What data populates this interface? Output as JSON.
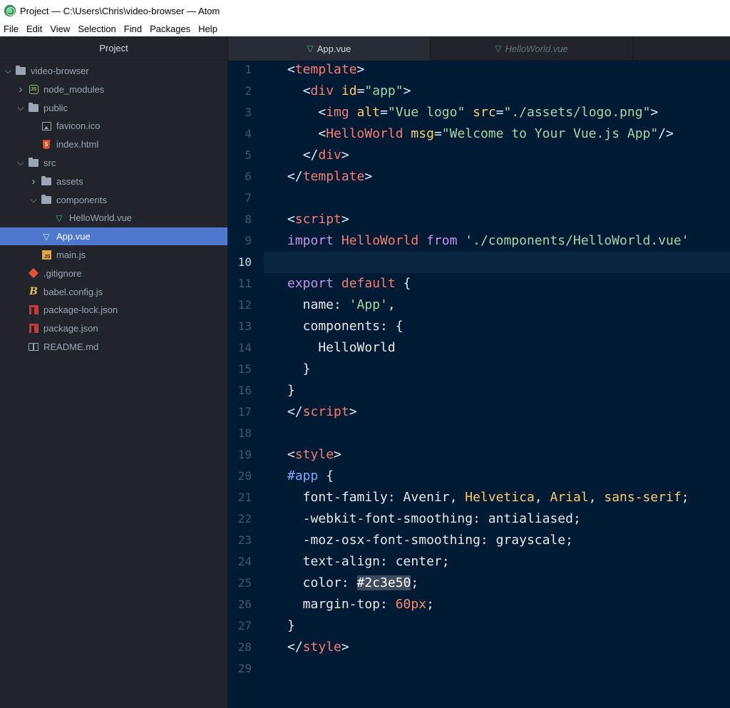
{
  "window": {
    "title": "Project — C:\\Users\\Chris\\video-browser — Atom"
  },
  "menu": [
    "File",
    "Edit",
    "View",
    "Selection",
    "Find",
    "Packages",
    "Help"
  ],
  "sidebar": {
    "header": "Project",
    "items": [
      {
        "label": "video-browser",
        "depth": 0,
        "expander": "open",
        "icon": "folder-icon"
      },
      {
        "label": "node_modules",
        "depth": 1,
        "expander": "closed",
        "icon": "node-icon"
      },
      {
        "label": "public",
        "depth": 1,
        "expander": "open",
        "icon": "folder-icon"
      },
      {
        "label": "favicon.ico",
        "depth": 2,
        "expander": "none",
        "icon": "image-file-icon"
      },
      {
        "label": "index.html",
        "depth": 2,
        "expander": "none",
        "icon": "html-file-icon"
      },
      {
        "label": "src",
        "depth": 1,
        "expander": "open",
        "icon": "folder-icon"
      },
      {
        "label": "assets",
        "depth": 2,
        "expander": "closed",
        "icon": "folder-icon"
      },
      {
        "label": "components",
        "depth": 2,
        "expander": "open",
        "icon": "folder-icon"
      },
      {
        "label": "HelloWorld.vue",
        "depth": 3,
        "expander": "none",
        "icon": "vue-file-icon"
      },
      {
        "label": "App.vue",
        "depth": 2,
        "expander": "none",
        "icon": "vue-file-icon",
        "selected": true
      },
      {
        "label": "main.js",
        "depth": 2,
        "expander": "none",
        "icon": "js-file-icon"
      },
      {
        "label": ".gitignore",
        "depth": 1,
        "expander": "none",
        "icon": "git-file-icon"
      },
      {
        "label": "babel.config.js",
        "depth": 1,
        "expander": "none",
        "icon": "babel-file-icon"
      },
      {
        "label": "package-lock.json",
        "depth": 1,
        "expander": "none",
        "icon": "npm-file-icon"
      },
      {
        "label": "package.json",
        "depth": 1,
        "expander": "none",
        "icon": "npm-file-icon"
      },
      {
        "label": "README.md",
        "depth": 1,
        "expander": "none",
        "icon": "readme-file-icon"
      }
    ]
  },
  "tabs": [
    {
      "label": "App.vue",
      "active": true
    },
    {
      "label": "HelloWorld.vue",
      "active": false
    }
  ],
  "editor": {
    "current_line": 10,
    "lines": [
      [
        [
          "c-bracket",
          "<"
        ],
        [
          "c-tag",
          "template"
        ],
        [
          "c-bracket",
          ">"
        ]
      ],
      [
        [
          "c-plain",
          "  "
        ],
        [
          "c-bracket",
          "<"
        ],
        [
          "c-tag",
          "div "
        ],
        [
          "c-attr",
          "id"
        ],
        [
          "c-bracket",
          "="
        ],
        [
          "c-string",
          "\"app\""
        ],
        [
          "c-bracket",
          ">"
        ]
      ],
      [
        [
          "c-plain",
          "    "
        ],
        [
          "c-bracket",
          "<"
        ],
        [
          "c-tag",
          "img "
        ],
        [
          "c-attr",
          "alt"
        ],
        [
          "c-bracket",
          "="
        ],
        [
          "c-string",
          "\"Vue logo\" "
        ],
        [
          "c-attr",
          "src"
        ],
        [
          "c-bracket",
          "="
        ],
        [
          "c-string",
          "\"./assets/logo.png\""
        ],
        [
          "c-bracket",
          ">"
        ]
      ],
      [
        [
          "c-plain",
          "    "
        ],
        [
          "c-bracket",
          "<"
        ],
        [
          "c-tag",
          "HelloWorld "
        ],
        [
          "c-attr",
          "msg"
        ],
        [
          "c-bracket",
          "="
        ],
        [
          "c-string",
          "\"Welcome to Your Vue.js App\""
        ],
        [
          "c-bracket",
          "/>"
        ]
      ],
      [
        [
          "c-plain",
          "  "
        ],
        [
          "c-bracket",
          "</"
        ],
        [
          "c-tag",
          "div"
        ],
        [
          "c-bracket",
          ">"
        ]
      ],
      [
        [
          "c-bracket",
          "</"
        ],
        [
          "c-tag",
          "template"
        ],
        [
          "c-bracket",
          ">"
        ]
      ],
      [],
      [
        [
          "c-bracket",
          "<"
        ],
        [
          "c-tag",
          "script"
        ],
        [
          "c-bracket",
          ">"
        ]
      ],
      [
        [
          "c-kw",
          "import "
        ],
        [
          "c-default",
          "HelloWorld "
        ],
        [
          "c-kw",
          "from "
        ],
        [
          "c-string",
          "'./components/HelloWorld.vue'"
        ]
      ],
      [],
      [
        [
          "c-kw",
          "export "
        ],
        [
          "c-default",
          "default "
        ],
        [
          "c-plain",
          "{"
        ]
      ],
      [
        [
          "c-plain",
          "  name: "
        ],
        [
          "c-string",
          "'App'"
        ],
        [
          "c-plain",
          ","
        ]
      ],
      [
        [
          "c-plain",
          "  components: {"
        ]
      ],
      [
        [
          "c-plain",
          "    HelloWorld"
        ]
      ],
      [
        [
          "c-plain",
          "  }"
        ]
      ],
      [
        [
          "c-plain",
          "}"
        ]
      ],
      [
        [
          "c-bracket",
          "</"
        ],
        [
          "c-tag",
          "script"
        ],
        [
          "c-bracket",
          ">"
        ]
      ],
      [],
      [
        [
          "c-bracket",
          "<"
        ],
        [
          "c-tag",
          "style"
        ],
        [
          "c-bracket",
          ">"
        ]
      ],
      [
        [
          "c-sel",
          "#app "
        ],
        [
          "c-plain",
          "{"
        ]
      ],
      [
        [
          "c-plain",
          "  font-family: Avenir, "
        ],
        [
          "c-font",
          "Helvetica"
        ],
        [
          "c-plain",
          ", "
        ],
        [
          "c-font",
          "Arial"
        ],
        [
          "c-plain",
          ", "
        ],
        [
          "c-font",
          "sans-serif"
        ],
        [
          "c-plain",
          ";"
        ]
      ],
      [
        [
          "c-plain",
          "  -webkit-font-smoothing: antialiased;"
        ]
      ],
      [
        [
          "c-plain",
          "  -moz-osx-font-smoothing: grayscale;"
        ]
      ],
      [
        [
          "c-plain",
          "  text-align: center;"
        ]
      ],
      [
        [
          "c-plain",
          "  color: "
        ],
        [
          "c-hexbg",
          "#2c3e50"
        ],
        [
          "c-plain",
          ";"
        ]
      ],
      [
        [
          "c-plain",
          "  margin-top: "
        ],
        [
          "c-num",
          "60px"
        ],
        [
          "c-plain",
          ";"
        ]
      ],
      [
        [
          "c-plain",
          "}"
        ]
      ],
      [
        [
          "c-bracket",
          "</"
        ],
        [
          "c-tag",
          "style"
        ],
        [
          "c-bracket",
          ">"
        ]
      ],
      []
    ]
  }
}
